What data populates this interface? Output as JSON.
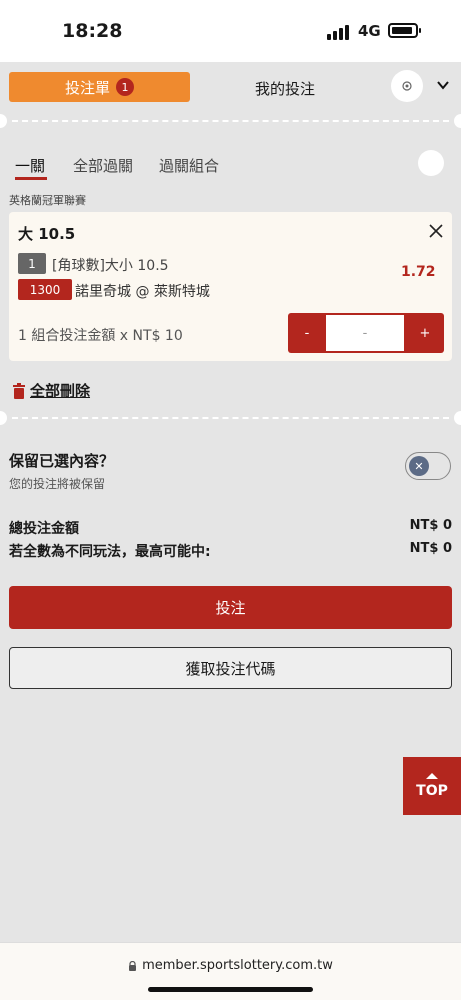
{
  "status_bar": {
    "time": "18:28",
    "network": "4G"
  },
  "header": {
    "betslip_tab": "投注單",
    "betslip_count": "1",
    "mybets_tab": "我的投注"
  },
  "subtabs": [
    "一關",
    "全部過關",
    "過關組合"
  ],
  "league": "英格蘭冠軍聯賽",
  "selection": {
    "title": "大 10.5",
    "num": "1",
    "market": "[角球數]大小 10.5",
    "odds": "1.72",
    "match_id": "1300",
    "match": "諾里奇城 @ 萊斯特城",
    "stake_label": "1 組合投注金額 x NT$ 10",
    "stepper_minus": "-",
    "stepper_value": "-",
    "stepper_plus": "+"
  },
  "delete_all": "全部刪除",
  "keep": {
    "title": "保留已選內容？",
    "desc": "您的投注將被保留",
    "toggle_on": false
  },
  "totals": {
    "stake_label": "總投注金額",
    "stake_value": "NT$ 0",
    "max_win_label": "若全數為不同玩法，最高可能中:",
    "max_win_value": "NT$ 0"
  },
  "buttons": {
    "bet": "投注",
    "get_code": "獲取投注代碼",
    "top": "TOP"
  },
  "url": "member.sportslottery.com.tw",
  "colors": {
    "accent": "#b3261e",
    "orange": "#ef8a2f"
  }
}
